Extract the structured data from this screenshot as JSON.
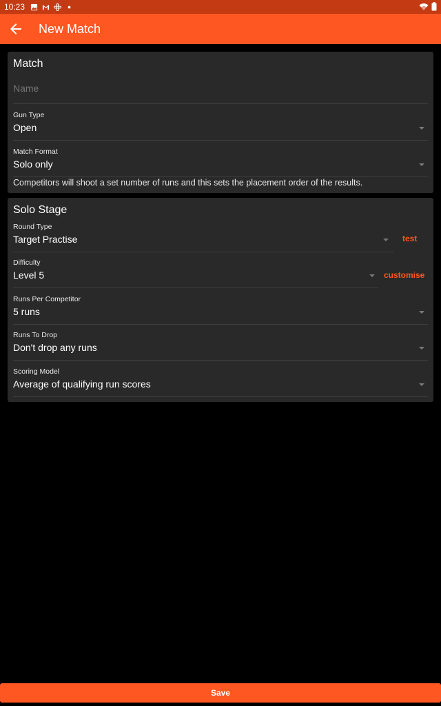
{
  "status_bar": {
    "time": "10:23"
  },
  "app_bar": {
    "title": "New Match"
  },
  "match_card": {
    "title": "Match",
    "name_placeholder": "Name",
    "gun_type": {
      "label": "Gun Type",
      "value": "Open"
    },
    "match_format": {
      "label": "Match Format",
      "value": "Solo only"
    },
    "format_description": "Competitors will shoot a set number of runs and this sets the placement order of the results."
  },
  "solo_stage_card": {
    "title": "Solo Stage",
    "round_type": {
      "label": "Round Type",
      "value": "Target Practise",
      "action": "test"
    },
    "difficulty": {
      "label": "Difficulty",
      "value": "Level 5",
      "action": "customise"
    },
    "runs_per_competitor": {
      "label": "Runs Per Competitor",
      "value": "5 runs"
    },
    "runs_to_drop": {
      "label": "Runs To Drop",
      "value": "Don't drop any runs"
    },
    "scoring_model": {
      "label": "Scoring Model",
      "value": "Average of qualifying run scores"
    }
  },
  "footer": {
    "save_label": "Save"
  },
  "colors": {
    "accent": "#ff5722",
    "status_bar": "#c43a12",
    "card": "#292929",
    "background": "#000000"
  }
}
